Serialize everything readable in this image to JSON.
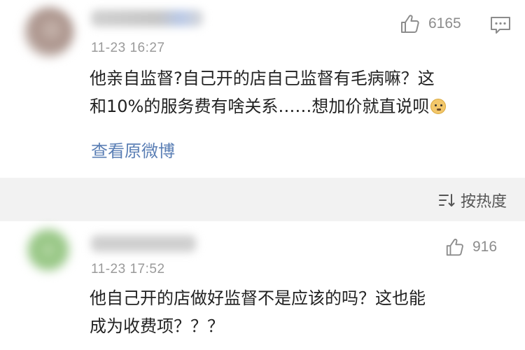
{
  "comments": [
    {
      "timestamp": "11-23 16:27",
      "text_lines": [
        "他亲自监督?自己开的店自己监督有毛病嘛？这",
        "和10%的服务费有啥关系……想加价就直说呗"
      ],
      "like_count": "6165",
      "link": "查看原微博",
      "emoji": "doge-icon"
    },
    {
      "timestamp": "11-23 17:52",
      "text_lines": [
        "他自己开的店做好监督不是应该的吗？这也能",
        "成为收费项？？？"
      ],
      "like_count": "916"
    }
  ],
  "sort": {
    "label": "按热度",
    "icon": "sort-icon"
  },
  "colors": {
    "link": "#5b7fb5",
    "meta": "#9a9a9a",
    "text": "#222222",
    "divider_bg": "#f2f2f2"
  }
}
